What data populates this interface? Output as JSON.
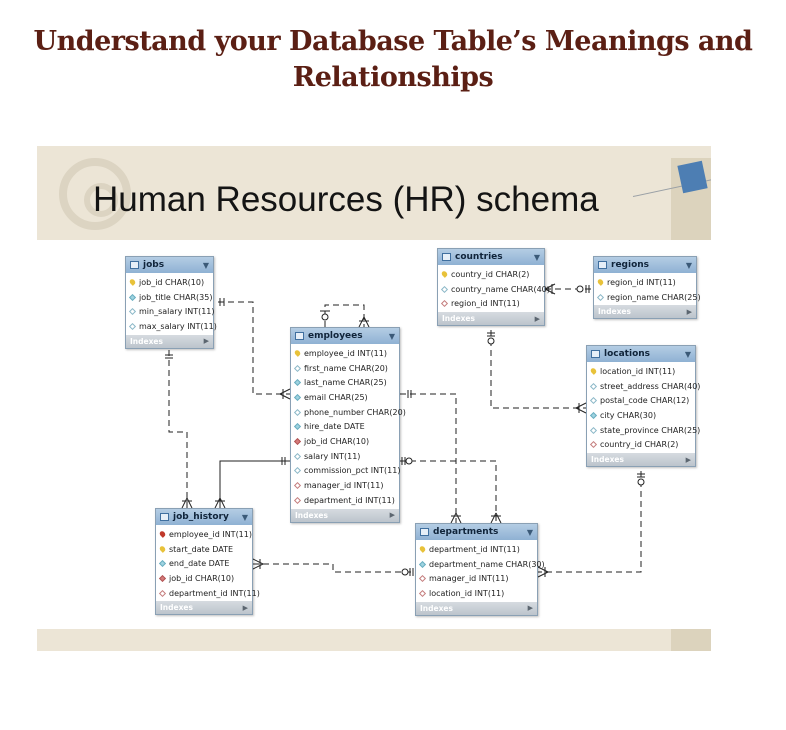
{
  "slide": {
    "title": "Understand your Database Table’s Meanings and Relationships",
    "banner_heading": "Human Resources (HR) schema"
  },
  "tables": {
    "jobs": {
      "name": "jobs",
      "footer": "Indexes",
      "columns": [
        {
          "text": "job_id CHAR(10)",
          "icon": "primary-key-icon"
        },
        {
          "text": "job_title CHAR(35)",
          "icon": "column-icon"
        },
        {
          "text": "min_salary INT(11)",
          "icon": "nullable-column-icon"
        },
        {
          "text": "max_salary INT(11)",
          "icon": "nullable-column-icon"
        }
      ]
    },
    "employees": {
      "name": "employees",
      "footer": "Indexes",
      "columns": [
        {
          "text": "employee_id INT(11)",
          "icon": "primary-key-icon"
        },
        {
          "text": "first_name CHAR(20)",
          "icon": "nullable-column-icon"
        },
        {
          "text": "last_name CHAR(25)",
          "icon": "column-icon"
        },
        {
          "text": "email CHAR(25)",
          "icon": "column-icon"
        },
        {
          "text": "phone_number CHAR(20)",
          "icon": "nullable-column-icon"
        },
        {
          "text": "hire_date DATE",
          "icon": "column-icon"
        },
        {
          "text": "job_id CHAR(10)",
          "icon": "foreign-key-icon"
        },
        {
          "text": "salary INT(11)",
          "icon": "nullable-column-icon"
        },
        {
          "text": "commission_pct INT(11)",
          "icon": "nullable-column-icon"
        },
        {
          "text": "manager_id INT(11)",
          "icon": "nullable-foreign-key-icon"
        },
        {
          "text": "department_id INT(11)",
          "icon": "nullable-foreign-key-icon"
        }
      ]
    },
    "countries": {
      "name": "countries",
      "footer": "Indexes",
      "columns": [
        {
          "text": "country_id CHAR(2)",
          "icon": "primary-key-icon"
        },
        {
          "text": "country_name CHAR(40)",
          "icon": "nullable-column-icon"
        },
        {
          "text": "region_id INT(11)",
          "icon": "nullable-foreign-key-icon"
        }
      ]
    },
    "regions": {
      "name": "regions",
      "footer": "Indexes",
      "columns": [
        {
          "text": "region_id INT(11)",
          "icon": "primary-key-icon"
        },
        {
          "text": "region_name CHAR(25)",
          "icon": "nullable-column-icon"
        }
      ]
    },
    "locations": {
      "name": "locations",
      "footer": "Indexes",
      "columns": [
        {
          "text": "location_id INT(11)",
          "icon": "primary-key-icon"
        },
        {
          "text": "street_address CHAR(40)",
          "icon": "nullable-column-icon"
        },
        {
          "text": "postal_code CHAR(12)",
          "icon": "nullable-column-icon"
        },
        {
          "text": "city CHAR(30)",
          "icon": "column-icon"
        },
        {
          "text": "state_province CHAR(25)",
          "icon": "nullable-column-icon"
        },
        {
          "text": "country_id CHAR(2)",
          "icon": "nullable-foreign-key-icon"
        }
      ]
    },
    "job_history": {
      "name": "job_history",
      "footer": "Indexes",
      "columns": [
        {
          "text": "employee_id INT(11)",
          "icon": "primary-foreign-key-icon"
        },
        {
          "text": "start_date DATE",
          "icon": "primary-key-icon"
        },
        {
          "text": "end_date DATE",
          "icon": "column-icon"
        },
        {
          "text": "job_id CHAR(10)",
          "icon": "foreign-key-icon"
        },
        {
          "text": "department_id INT(11)",
          "icon": "nullable-foreign-key-icon"
        }
      ]
    },
    "departments": {
      "name": "departments",
      "footer": "Indexes",
      "columns": [
        {
          "text": "department_id INT(11)",
          "icon": "primary-key-icon"
        },
        {
          "text": "department_name CHAR(30)",
          "icon": "column-icon"
        },
        {
          "text": "manager_id INT(11)",
          "icon": "nullable-foreign-key-icon"
        },
        {
          "text": "location_id INT(11)",
          "icon": "nullable-foreign-key-icon"
        }
      ]
    }
  }
}
